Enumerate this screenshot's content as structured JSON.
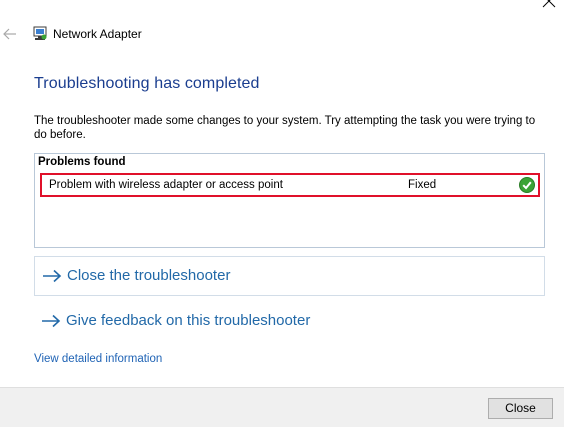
{
  "window": {
    "title": "Network Adapter",
    "icon": "network-troubleshooter-icon"
  },
  "main": {
    "heading": "Troubleshooting has completed",
    "description": "The troubleshooter made some changes to your system. Try attempting the task you were trying to do before."
  },
  "problems": {
    "header": "Problems found",
    "items": [
      {
        "name": "Problem with wireless adapter or access point",
        "status": "Fixed",
        "status_icon": "green-check-icon"
      }
    ]
  },
  "actions": {
    "close_troubleshooter": "Close the troubleshooter",
    "give_feedback": "Give feedback on this troubleshooter"
  },
  "detail_link": "View detailed information",
  "footer": {
    "close_label": "Close"
  },
  "colors": {
    "heading": "#1a3d8f",
    "link": "#2269a8",
    "highlight_border": "#e0102a",
    "fixed_check": "#3aa335"
  }
}
